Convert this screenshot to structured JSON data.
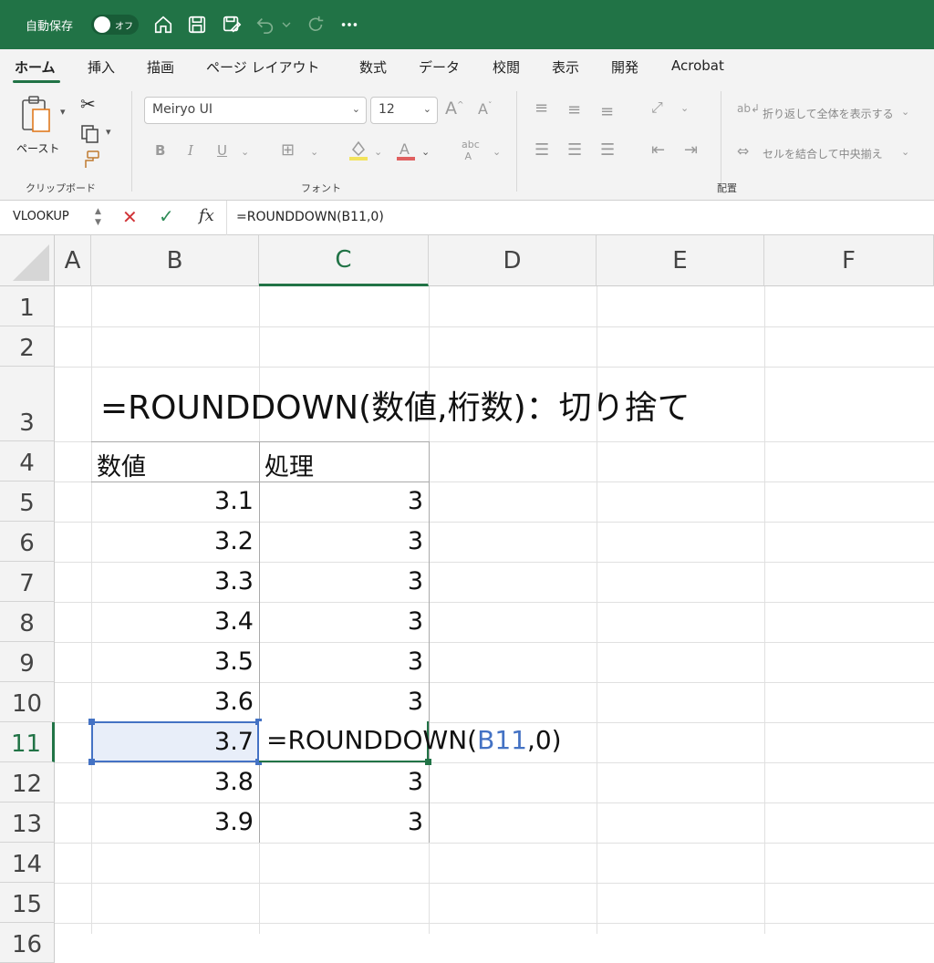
{
  "titlebar": {
    "autosave_label": "自動保存",
    "toggle_label": "オフ",
    "icons": [
      "home-icon",
      "save-icon",
      "save-as-icon",
      "undo-icon",
      "redo-icon",
      "more-icon"
    ]
  },
  "menu": {
    "tabs": [
      "ホーム",
      "挿入",
      "描画",
      "ページ レイアウト",
      "数式",
      "データ",
      "校閲",
      "表示",
      "開発",
      "Acrobat"
    ],
    "active": "ホーム"
  },
  "ribbon": {
    "paste_label": "ペースト",
    "clipboard_group": "クリップボード",
    "font_group": "フォント",
    "alignment_group": "配置",
    "font_name": "Meiryo UI",
    "font_size": "12",
    "wrap_text_label": "折り返して全体を表示する",
    "merge_center_label": "セルを結合して中央揃え"
  },
  "formula_bar": {
    "name_box": "VLOOKUP",
    "fx": "fx",
    "formula": "=ROUNDDOWN(B11,0)"
  },
  "sheet": {
    "columns": [
      "A",
      "B",
      "C",
      "D",
      "E",
      "F"
    ],
    "rows": [
      "1",
      "2",
      "3",
      "4",
      "5",
      "6",
      "7",
      "8",
      "9",
      "10",
      "11",
      "12",
      "13",
      "14",
      "15",
      "16"
    ],
    "title": "=ROUNDDOWN(数値,桁数)：切り捨て",
    "header_b": "数値",
    "header_c": "処理",
    "values_b": [
      "3.1",
      "3.2",
      "3.3",
      "3.4",
      "3.5",
      "3.6",
      "3.7",
      "3.8",
      "3.9"
    ],
    "values_c": [
      "3",
      "3",
      "3",
      "3",
      "3",
      "3",
      "",
      "3",
      "3"
    ],
    "editing": {
      "prefix": "=ROUNDDOWN(",
      "ref": "B11",
      "suffix": ",0)"
    }
  },
  "colors": {
    "accent": "#217346",
    "selection": "#4472c4"
  }
}
